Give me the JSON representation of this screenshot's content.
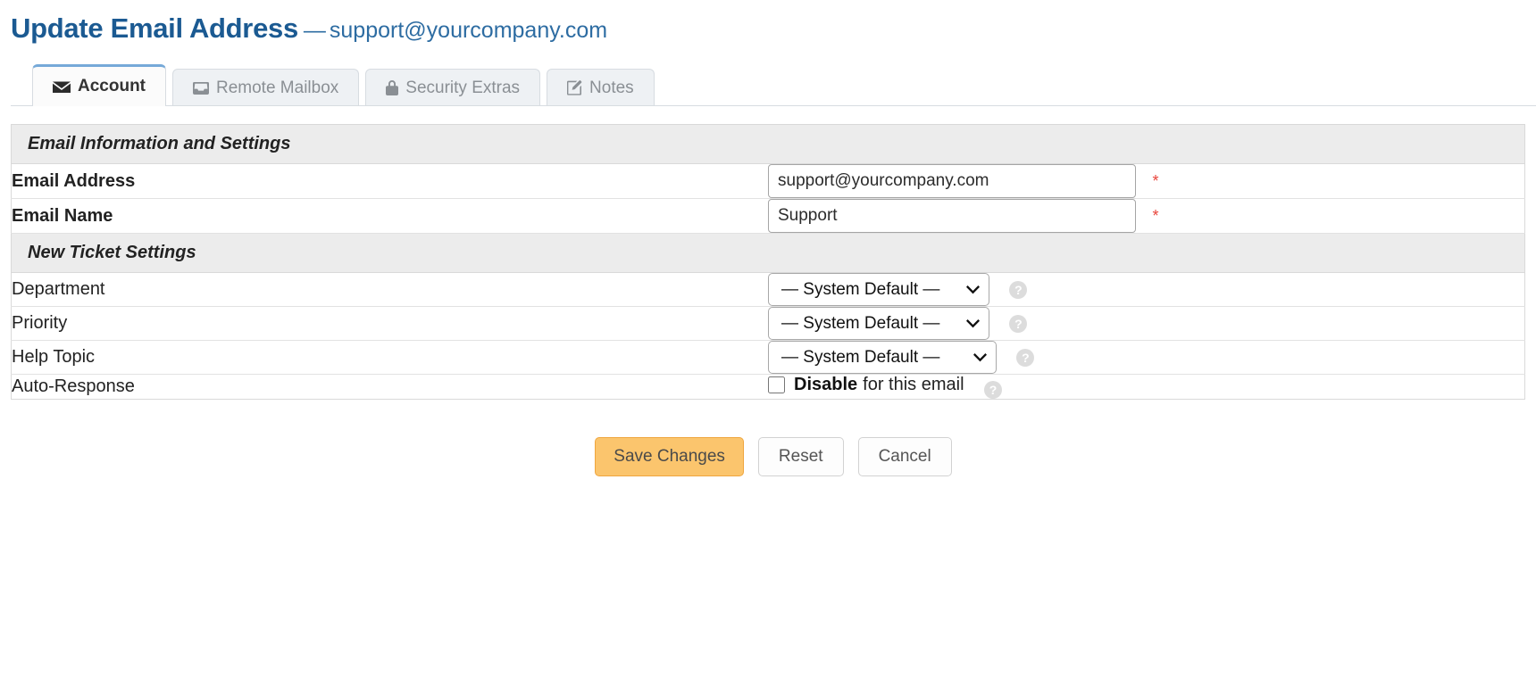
{
  "header": {
    "title": "Update Email Address",
    "separator": "—",
    "subject": "support@yourcompany.com"
  },
  "tabs": [
    {
      "label": "Account",
      "icon": "envelope-icon",
      "active": true
    },
    {
      "label": "Remote Mailbox",
      "icon": "inbox-icon",
      "active": false
    },
    {
      "label": "Security Extras",
      "icon": "lock-icon",
      "active": false
    },
    {
      "label": "Notes",
      "icon": "edit-square-icon",
      "active": false
    }
  ],
  "sections": {
    "email_info": {
      "title": "Email Information and Settings",
      "email_address": {
        "label": "Email Address",
        "value": "support@yourcompany.com",
        "placeholder": "",
        "required_marker": "*"
      },
      "email_name": {
        "label": "Email Name",
        "value": "Support",
        "placeholder": "",
        "required_marker": "*"
      }
    },
    "new_ticket": {
      "title": "New Ticket Settings",
      "department": {
        "label": "Department",
        "selected": "— System Default —",
        "help": "?"
      },
      "priority": {
        "label": "Priority",
        "selected": "— System Default —",
        "help": "?"
      },
      "help_topic": {
        "label": "Help Topic",
        "selected": "— System Default —",
        "help": "?"
      },
      "auto_response": {
        "label": "Auto-Response",
        "checkbox_strong": "Disable",
        "checkbox_rest": "for this email",
        "checked": false,
        "help": "?"
      }
    }
  },
  "buttons": {
    "save": "Save Changes",
    "reset": "Reset",
    "cancel": "Cancel"
  },
  "colors": {
    "title_blue": "#1b5a92",
    "subject_blue": "#2d6ca2",
    "active_tab_top": "#76a9d8",
    "section_band": "#ececec",
    "required_red": "#e8453c",
    "save_fill": "#fbc56d",
    "save_border": "#efa63f",
    "help_icon_bg": "#dcdcdc"
  }
}
